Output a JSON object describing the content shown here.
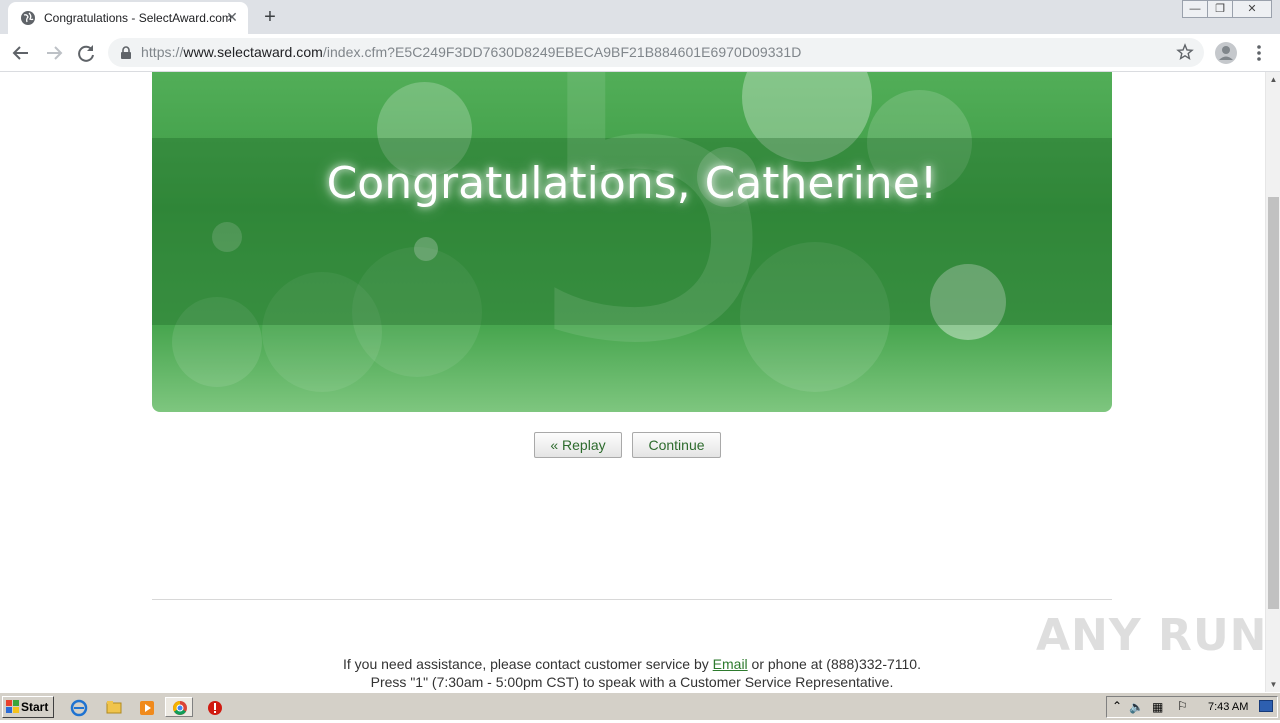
{
  "browser": {
    "tab": {
      "title": "Congratulations - SelectAward.com",
      "close_glyph": "✕"
    },
    "new_tab_glyph": "+",
    "window_controls": {
      "minimize": "—",
      "restore": "❐",
      "close": "✕"
    },
    "address": {
      "scheme": "https://",
      "host": "www.selectaward.com",
      "path": "/index.cfm?E5C249F3DD7630D8249EBECA9BF21B884601E6970D09331D"
    },
    "icons": {
      "back": "back-arrow-icon",
      "forward": "forward-arrow-icon",
      "reload": "reload-icon",
      "lock": "lock-icon",
      "star": "bookmark-star-icon",
      "profile": "profile-icon",
      "menu": "kebab-menu-icon"
    }
  },
  "page": {
    "headline": "Congratulations, Catherine!",
    "banner_numeral": "5",
    "buttons": {
      "replay": "« Replay",
      "continue": "Continue"
    },
    "footer": {
      "line1_before": "If you need assistance, please contact customer service by ",
      "email_link": "Email",
      "line1_after": " or phone at (888)332-7110.",
      "line2": "Press \"1\" (7:30am - 5:00pm CST) to speak with a Customer Service Representative."
    },
    "colors": {
      "banner_green": "#3c9a44",
      "button_text": "#2d6b2d",
      "link": "#2d7a2d"
    }
  },
  "watermark": "ANY  RUN",
  "taskbar": {
    "start_label": "Start",
    "clock": "7:43 AM",
    "apps": [
      "internet-explorer-icon",
      "folder-icon",
      "media-player-icon",
      "chrome-icon",
      "stop-icon"
    ]
  }
}
